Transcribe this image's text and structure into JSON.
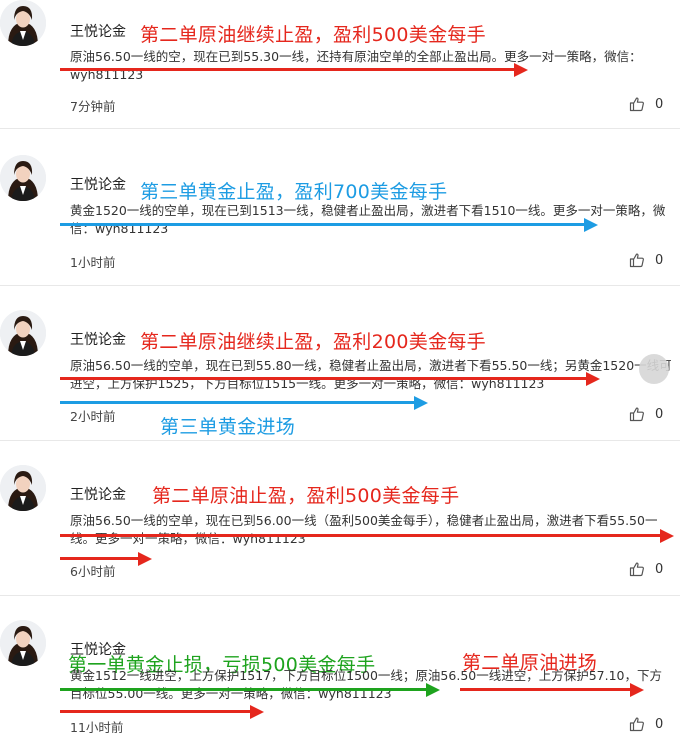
{
  "posts": [
    {
      "author": "王悦论金",
      "headline": "第二单原油继续止盈，盈利500美金每手",
      "body": "原油56.50一线的空，现在已到55.30一线，还持有原油空单的全部止盈出局。更多一对一策略，微信：wyh811123",
      "time": "7分钟前",
      "likes": "0"
    },
    {
      "author": "王悦论金",
      "headline": "第三单黄金止盈，盈利700美金每手",
      "body": "黄金1520一线的空单，现在已到1513一线，稳健者止盈出局，激进者下看1510一线。更多一对一策略，微信：wyh811123",
      "time": "1小时前",
      "likes": "0"
    },
    {
      "author": "王悦论金",
      "headline": "第二单原油继续止盈，盈利200美金每手",
      "body": "原油56.50一线的空单，现在已到55.80一线，稳健者止盈出局，激进者下看55.50一线；另黄金1520一线可进空，上方保护1525，下方目标位1515一线。更多一对一策略，微信：wyh811123",
      "time": "2小时前",
      "likes": "0",
      "extra_label": "第三单黄金进场"
    },
    {
      "author": "王悦论金",
      "headline": "第二单原油止盈，盈利500美金每手",
      "body": "原油56.50一线的空单，现在已到56.00一线（盈利500美金每手），稳健者止盈出局，激进者下看55.50一线。更多一对一策略，微信：wyh811123",
      "time": "6小时前",
      "likes": "0"
    },
    {
      "author": "王悦论金",
      "headline": "第一单黄金止损，亏损500美金每手",
      "body": "黄金1512一线进空，上方保护1517，下方目标位1500一线；原油56.50一线进空，上方保护57.10，下方目标位55.00一线。更多一对一策略，微信：wyh811123",
      "time": "11小时前",
      "likes": "0",
      "extra_label": "第二单原油进场"
    }
  ],
  "colors": {
    "red": "#e5271d",
    "blue": "#1d9ce3",
    "green": "#1ea31e"
  },
  "icons": {
    "like": "thumbs-up-icon",
    "avatar": "avatar-portrait"
  }
}
